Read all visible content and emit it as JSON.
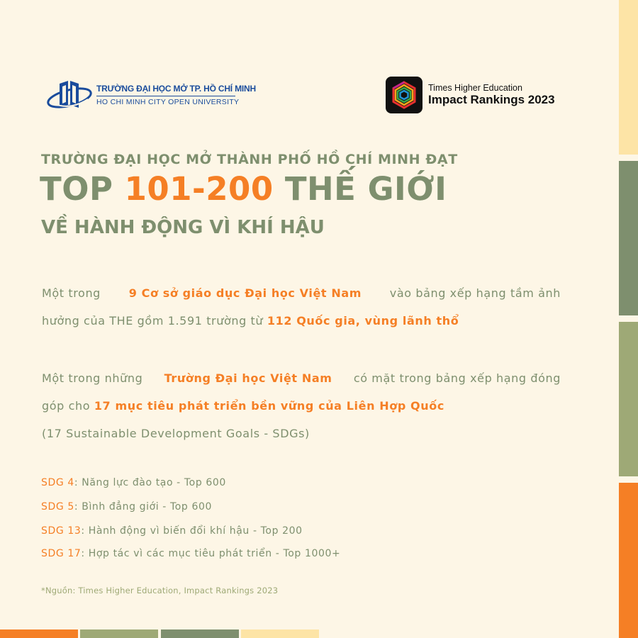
{
  "colors": {
    "background": "#fdf6e6",
    "sage": "#7e8f6e",
    "olive": "#9ea976",
    "cream": "#fde4a6",
    "orange": "#f57f25",
    "university_blue": "#1a4c9c"
  },
  "university_logo": {
    "name_vi": "TRƯỜNG ĐẠI HỌC MỞ TP. HỒ CHÍ MINH",
    "name_en": "HO CHI MINH CITY OPEN UNIVERSITY"
  },
  "the_logo": {
    "line1": "Times Higher Education",
    "line2": "Impact Rankings 2023"
  },
  "headline": {
    "line1": "TRƯỜNG ĐẠI HỌC MỞ THÀNH PHỐ HỒ CHÍ MINH ĐẠT",
    "line2_prefix": "TOP",
    "line2_highlight": "101-200",
    "line2_suffix": "THẾ GIỚI",
    "line3": "VỀ HÀNH ĐỘNG VÌ KHÍ HẬU"
  },
  "paragraph1": {
    "l1_a": "Một trong",
    "l1_hl": "9 Cơ sở giáo dục Đại học Việt Nam",
    "l1_b": "vào bảng xếp hạng tầm ảnh",
    "l2_a": "hưởng của THE gồm 1.591 trường từ",
    "l2_hl": "112 Quốc gia, vùng lãnh thổ"
  },
  "paragraph2": {
    "l1_a": "Một trong những",
    "l1_hl": "Trường Đại học Việt Nam",
    "l1_b": "có mặt trong bảng xếp hạng đóng",
    "l2_a": "góp cho",
    "l2_hl": "17 mục tiêu phát triển bền vững của Liên Hợp Quốc",
    "l3": "(17 Sustainable Development Goals - SDGs)"
  },
  "sdgs": [
    {
      "code": "SDG 4",
      "text": ": Năng lực đào tạo - Top 600"
    },
    {
      "code": "SDG 5",
      "text": ": Bình đẳng giới - Top 600"
    },
    {
      "code": "SDG 13",
      "text": ": Hành động vì biến đổi khí hậu - Top 200"
    },
    {
      "code": "SDG 17",
      "text": ": Hợp tác vì các mục tiêu phát triển - Top 1000+"
    }
  ],
  "source": "*Nguồn: Times Higher Education, Impact Rankings 2023"
}
